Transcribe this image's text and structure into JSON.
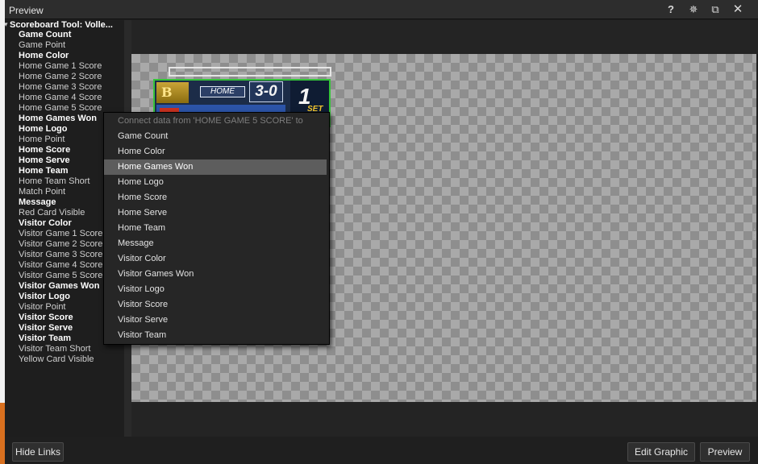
{
  "window": {
    "title": "Preview"
  },
  "titlebar": {
    "help_icon": "question-icon",
    "pin_icon": "pin-icon",
    "restore_icon": "restore-window-icon",
    "close_icon": "close-icon",
    "help_glyph": "?",
    "pin_glyph": "✵",
    "restore_glyph": "⧉",
    "close_glyph": "✕"
  },
  "tree": {
    "root": "Scoreboard Tool: Volle...",
    "items": [
      {
        "label": "Game Count",
        "bold": true
      },
      {
        "label": "Game Point",
        "bold": false
      },
      {
        "label": "Home Color",
        "bold": true
      },
      {
        "label": "Home Game 1 Score",
        "bold": false
      },
      {
        "label": "Home Game 2 Score",
        "bold": false
      },
      {
        "label": "Home Game 3 Score",
        "bold": false
      },
      {
        "label": "Home Game 4 Score",
        "bold": false
      },
      {
        "label": "Home Game 5 Score",
        "bold": false
      },
      {
        "label": "Home Games Won",
        "bold": true
      },
      {
        "label": "Home Logo",
        "bold": true
      },
      {
        "label": "Home Point",
        "bold": false
      },
      {
        "label": "Home Score",
        "bold": true
      },
      {
        "label": "Home Serve",
        "bold": true
      },
      {
        "label": "Home Team",
        "bold": true
      },
      {
        "label": "Home Team Short",
        "bold": false
      },
      {
        "label": "Match Point",
        "bold": false
      },
      {
        "label": "Message",
        "bold": true
      },
      {
        "label": "Red Card Visible",
        "bold": false
      },
      {
        "label": "Visitor Color",
        "bold": true
      },
      {
        "label": "Visitor Game 1 Score",
        "bold": false
      },
      {
        "label": "Visitor Game 2 Score",
        "bold": false
      },
      {
        "label": "Visitor Game 3 Score",
        "bold": false
      },
      {
        "label": "Visitor Game 4 Score",
        "bold": false
      },
      {
        "label": "Visitor Game 5 Score",
        "bold": false
      },
      {
        "label": "Visitor Games Won",
        "bold": true
      },
      {
        "label": "Visitor Logo",
        "bold": true
      },
      {
        "label": "Visitor Point",
        "bold": false
      },
      {
        "label": "Visitor Score",
        "bold": true
      },
      {
        "label": "Visitor Serve",
        "bold": true
      },
      {
        "label": "Visitor Team",
        "bold": true
      },
      {
        "label": "Visitor Team Short",
        "bold": false
      },
      {
        "label": "Yellow Card Visible",
        "bold": false
      }
    ]
  },
  "scoreboard": {
    "team_label": "HOME",
    "games_won": "3-0",
    "set_number": "1",
    "set_label": "SET",
    "logo_letter": "B"
  },
  "context_menu": {
    "header": "Connect data from 'HOME GAME 5 SCORE' to",
    "highlighted_index": 2,
    "items": [
      "Game Count",
      "Home Color",
      "Home Games Won",
      "Home Logo",
      "Home Score",
      "Home Serve",
      "Home Team",
      "Message",
      "Visitor Color",
      "Visitor Games Won",
      "Visitor Logo",
      "Visitor Score",
      "Visitor Serve",
      "Visitor Team"
    ]
  },
  "footer": {
    "hide_links": "Hide Links",
    "edit_graphic": "Edit Graphic",
    "preview": "Preview"
  },
  "colors": {
    "accent_green": "#36c43a",
    "menu_highlight": "#5d5d5d",
    "set_label": "#f2c52e"
  }
}
